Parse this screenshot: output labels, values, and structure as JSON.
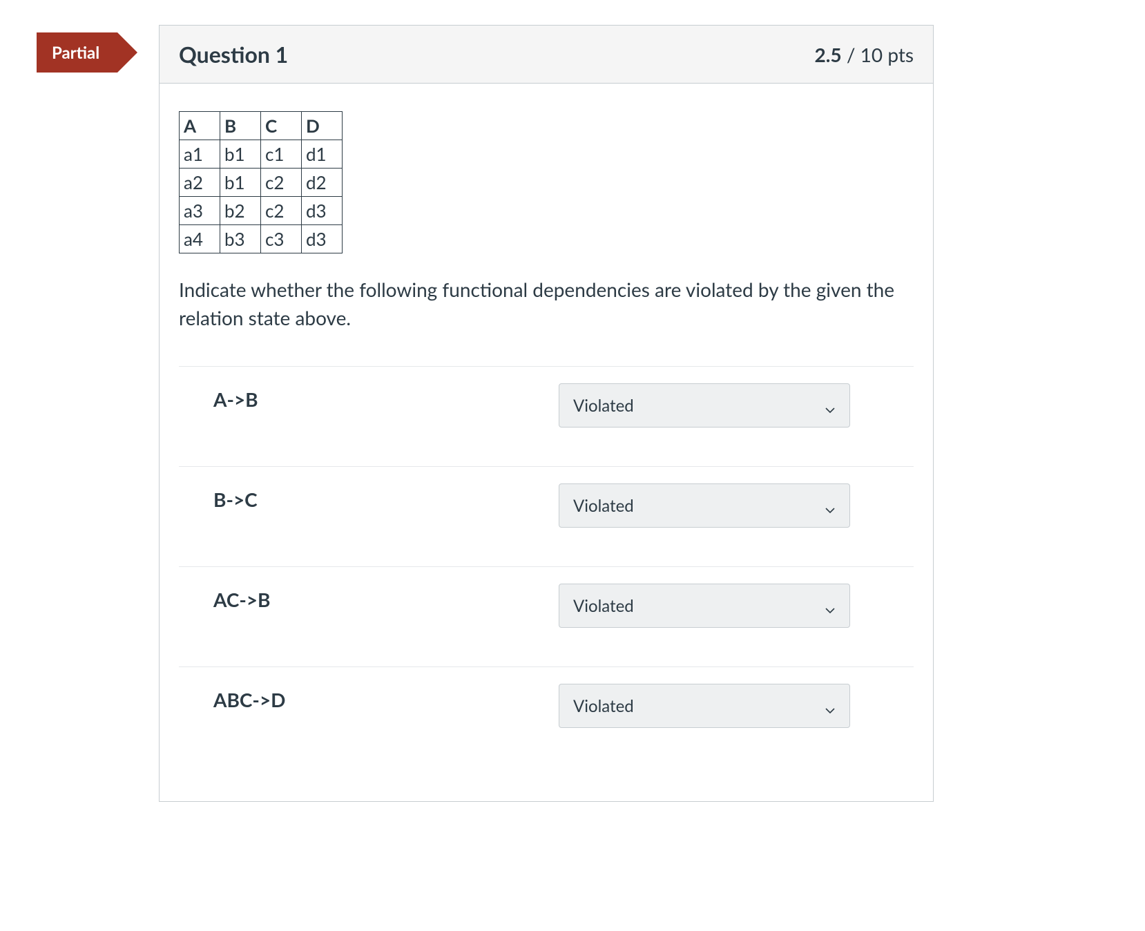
{
  "status_badge": "Partial",
  "header": {
    "title": "Question 1",
    "points_earned": "2.5",
    "points_sep": " / ",
    "points_total": "10 pts"
  },
  "table": {
    "headers": [
      "A",
      "B",
      "C",
      "D"
    ],
    "rows": [
      [
        "a1",
        "b1",
        "c1",
        "d1"
      ],
      [
        "a2",
        "b1",
        "c2",
        "d2"
      ],
      [
        "a3",
        "b2",
        "c2",
        "d3"
      ],
      [
        "a4",
        "b3",
        "c3",
        "d3"
      ]
    ]
  },
  "prompt": "Indicate whether the following functional dependencies are violated by the given the relation state above.",
  "fds": [
    {
      "label": "A->B",
      "selected": "Violated"
    },
    {
      "label": "B->C",
      "selected": "Violated"
    },
    {
      "label": "AC->B",
      "selected": "Violated"
    },
    {
      "label": "ABC->D",
      "selected": "Violated"
    }
  ]
}
